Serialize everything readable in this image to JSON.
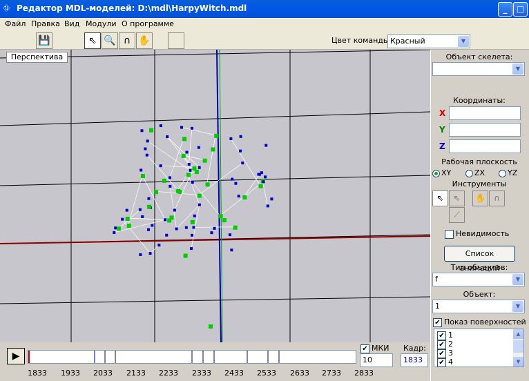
{
  "window": {
    "title": "Редактор MDL-моделей: D:\\mdl\\HarpyWitch.mdl",
    "icon": "app-icon"
  },
  "menu": [
    "Файл",
    "Правка",
    "Вид",
    "Модули",
    "О программе"
  ],
  "toolbar": {
    "tools": [
      "save-icon",
      "pointer-icon",
      "zoom-icon",
      "rotate-icon",
      "pan-hand-icon"
    ],
    "team_color_label": "Цвет команды:",
    "team_color_value": "Красный"
  },
  "viewport": {
    "tab_label": "Перспектива",
    "colors": {
      "background": "#c8c6cd",
      "x_axis": "#8b0000",
      "z_axis": "#0000b0",
      "grid": "#000000",
      "vertex_green": "#00cc00",
      "vertex_blue": "#0000cc",
      "mesh": "#ffffff"
    }
  },
  "timeline": {
    "ticks": [
      "1833",
      "1933",
      "2033",
      "2133",
      "2233",
      "2333",
      "2433",
      "2533",
      "2633",
      "2733",
      "2833"
    ],
    "mki_label": "МКИ",
    "mki_value": "10",
    "frame_label": "Кадр:",
    "frame_value": "1833"
  },
  "panel": {
    "skeleton_label": "Объект скелета:",
    "skeleton_value": "",
    "coords_label": "Координаты:",
    "axes": [
      {
        "name": "X",
        "color": "#cc0000",
        "value": ""
      },
      {
        "name": "Y",
        "color": "#008000",
        "value": ""
      },
      {
        "name": "Z",
        "color": "#0000cc",
        "value": ""
      }
    ],
    "plane_label": "Рабочая плоскость",
    "planes": [
      "XY",
      "ZX",
      "YZ"
    ],
    "tools_label": "Инструменты",
    "invisibility_label": "Невидимость",
    "anim_list_button": "Список анимаций",
    "object_type_label": "Тип объектов:",
    "object_type_value": "f",
    "object_label": "Объект:",
    "object_value": "1",
    "show_surfaces_label": "Показ поверхностей",
    "surfaces": [
      "1",
      "2",
      "3",
      "4"
    ]
  }
}
